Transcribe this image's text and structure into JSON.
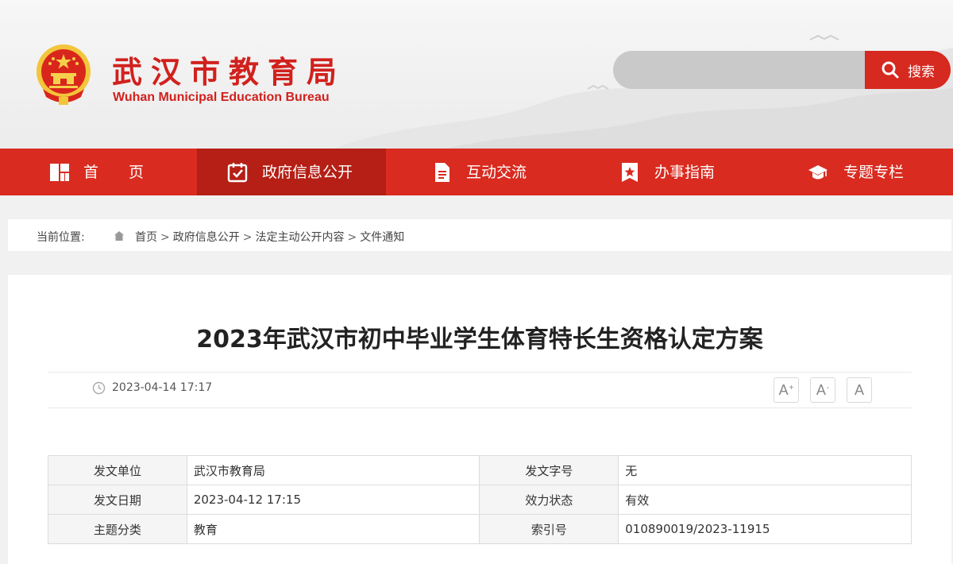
{
  "header": {
    "title": "武汉市教育局",
    "subtitle": "Wuhan Municipal Education Bureau",
    "emblem_icon": "national-emblem-icon",
    "search": {
      "placeholder": "",
      "value": "",
      "button_label": "搜索",
      "button_icon": "search-icon"
    }
  },
  "nav": {
    "items": [
      {
        "label": "首　　页",
        "icon": "home-grid-icon",
        "active": false
      },
      {
        "label": "政府信息公开",
        "icon": "calendar-check-icon",
        "active": true
      },
      {
        "label": "互动交流",
        "icon": "document-icon",
        "active": false
      },
      {
        "label": "办事指南",
        "icon": "bookmark-star-icon",
        "active": false
      },
      {
        "label": "专题专栏",
        "icon": "graduation-cap-icon",
        "active": false
      }
    ]
  },
  "breadcrumb": {
    "label": "当前位置:",
    "items": [
      "首页",
      "政府信息公开",
      "法定主动公开内容",
      "文件通知"
    ],
    "separator": ">"
  },
  "article": {
    "title": "2023年武汉市初中毕业学生体育特长生资格认定方案",
    "publish_time": "2023-04-14 17:17",
    "font_controls": {
      "increase": "A",
      "increase_mark": "+",
      "decrease": "A",
      "decrease_mark": "-",
      "reset": "A"
    },
    "info": [
      [
        {
          "k": "发文单位",
          "v": "武汉市教育局"
        },
        {
          "k": "发文字号",
          "v": "无"
        }
      ],
      [
        {
          "k": "发文日期",
          "v": "2023-04-12 17:15"
        },
        {
          "k": "效力状态",
          "v": "有效"
        }
      ],
      [
        {
          "k": "主题分类",
          "v": "教育"
        },
        {
          "k": "索引号",
          "v": "010890019/2023-11915"
        }
      ]
    ]
  },
  "colors": {
    "brand_red": "#d1211d",
    "nav_red": "#d92b20",
    "nav_active": "#b51f15",
    "search_button": "#d6291f"
  }
}
